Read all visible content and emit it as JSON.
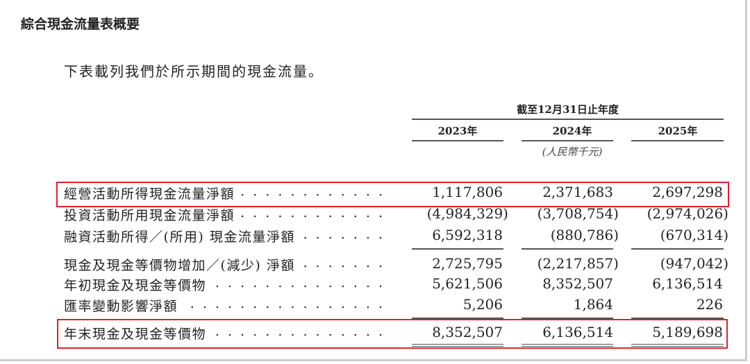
{
  "title": "綜合現金流量表概要",
  "intro": "下表載列我們於所示期間的現金流量。",
  "header": {
    "period": "截至12月31日止年度",
    "years": [
      "2023年",
      "2024年",
      "2025年"
    ],
    "unit": "(人民幣千元)"
  },
  "rows": [
    {
      "label": "經營活動所得現金流量淨額",
      "values": [
        "1,117,806",
        "2,371,683",
        "2,697,298"
      ],
      "highlighted": true
    },
    {
      "label": "投資活動所用現金流量淨額",
      "values": [
        "(4,984,329)",
        "(3,708,754)",
        "(2,974,026)"
      ]
    },
    {
      "label": "融資活動所得／(所用) 現金流量淨額",
      "values": [
        "6,592,318",
        "(880,786)",
        "(670,314)"
      ]
    },
    {
      "label": "現金及現金等價物增加／(減少) 淨額",
      "values": [
        "2,725,795",
        "(2,217,857)",
        "(947,042)"
      ]
    },
    {
      "label": "年初現金及現金等價物",
      "values": [
        "5,621,506",
        "8,352,507",
        "6,136,514"
      ]
    },
    {
      "label": "匯率變動影響淨額",
      "values": [
        "5,206",
        "1,864",
        "226"
      ]
    },
    {
      "label": "年末現金及現金等價物",
      "values": [
        "8,352,507",
        "6,136,514",
        "5,189,698"
      ],
      "highlighted": true
    }
  ],
  "dots": ". . . . . . . . . . . . . . . .",
  "colors": {
    "highlight": "#e0202a"
  }
}
